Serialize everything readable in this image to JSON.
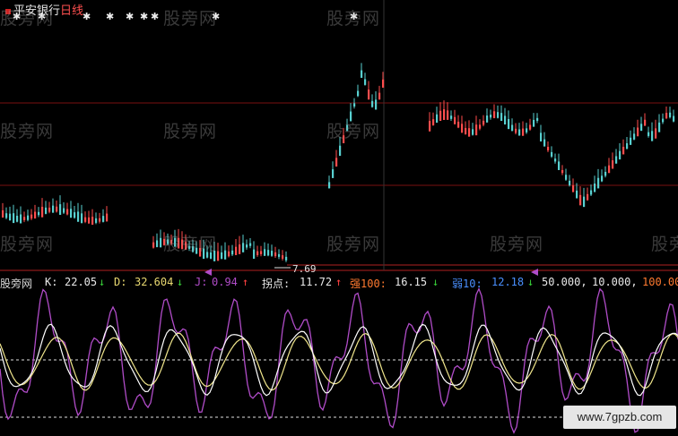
{
  "header": {
    "stock_name": "平安银行",
    "period": "日线"
  },
  "price_panel": {
    "low_marker_label": "7.69"
  },
  "indicator_bar": {
    "name": "股旁网",
    "k_label": "K:",
    "k_value": "22.05",
    "k_arrow": "↓",
    "d_label": "D:",
    "d_value": "32.604",
    "d_arrow": "↓",
    "j_label": "J:",
    "j_value": "0.94",
    "j_arrow": "↑",
    "pivot_label": "拐点:",
    "pivot_value": "11.72",
    "pivot_arrow": "↑",
    "strong_label": "强100:",
    "strong_value": "16.15",
    "strong_arrow": "↓",
    "weak_label": "弱10:",
    "weak_value": "12.18",
    "weak_arrow": "↓",
    "level_50": "50.000,",
    "level_10": "10.000,",
    "level_100": "100.00"
  },
  "watermarks": [
    "股旁网",
    "股旁网",
    "股旁网",
    "股旁网",
    "股旁网",
    "股旁网",
    "股旁网",
    "股旁网",
    "股旁网",
    "股旁网",
    "股旁网"
  ],
  "site_badge": "www.7gpzb.com",
  "colors": {
    "background": "#000000",
    "up_candle": "#ff4d4d",
    "down_candle": "#58d0d0",
    "grid": "#7a1010",
    "k_line": "#ffffff",
    "d_line": "#f0e68c",
    "j_line": "#b04cc8",
    "divider": "#b02020"
  }
}
